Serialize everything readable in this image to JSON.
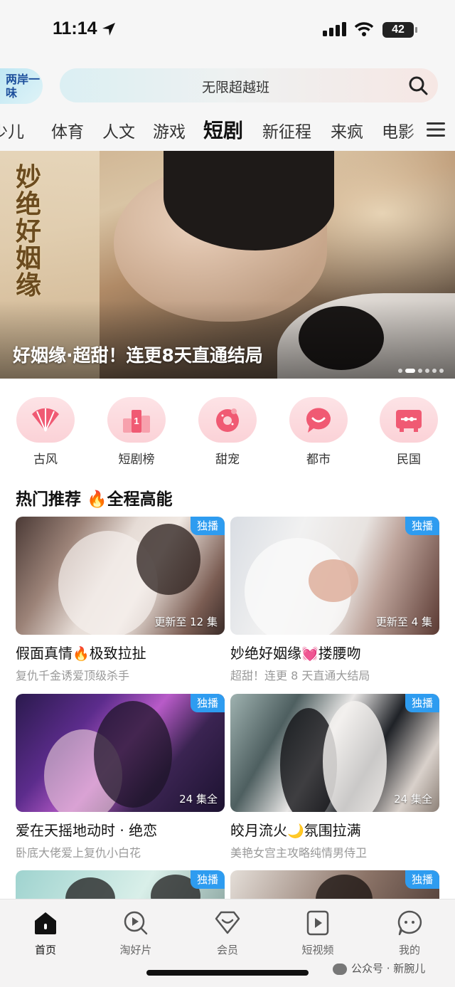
{
  "status_bar": {
    "time": "11:14",
    "battery": "42"
  },
  "header": {
    "brand_logo": "两岸一味",
    "search_placeholder": "无限超越班"
  },
  "tabs": [
    {
      "label": "少儿",
      "active": false
    },
    {
      "label": "体育",
      "active": false
    },
    {
      "label": "人文",
      "active": false
    },
    {
      "label": "游戏",
      "active": false
    },
    {
      "label": "短剧",
      "active": true
    },
    {
      "label": "新征程",
      "active": false
    },
    {
      "label": "来疯",
      "active": false
    },
    {
      "label": "电影",
      "active": false
    }
  ],
  "banner": {
    "calligraphy": "妙绝好姻缘",
    "title": "好姻缘·超甜！连更8天直通结局",
    "page_count": 6,
    "active_index": 1
  },
  "categories": [
    {
      "label": "古风",
      "icon": "fan-icon"
    },
    {
      "label": "短剧榜",
      "icon": "ranking-icon"
    },
    {
      "label": "甜宠",
      "icon": "donut-icon"
    },
    {
      "label": "都市",
      "icon": "speech-bubble-icon"
    },
    {
      "label": "民国",
      "icon": "radio-icon"
    }
  ],
  "section": {
    "title": "热门推荐",
    "emoji": "🔥",
    "subtitle": "全程高能"
  },
  "cards": [
    {
      "badge": "独播",
      "note": "更新至 12 集",
      "title_a": "假面真情",
      "emoji": "🔥",
      "title_b": "极致拉扯",
      "subtitle": "复仇千金诱爱顶级杀手"
    },
    {
      "badge": "独播",
      "note": "更新至 4 集",
      "title_a": "妙绝好姻缘",
      "emoji": "💓",
      "title_b": "搂腰吻",
      "subtitle": "超甜！连更 8 天直通大结局"
    },
    {
      "badge": "独播",
      "note": "24 集全",
      "title_a": "爱在天摇地动时 · 绝恋",
      "emoji": "",
      "title_b": "",
      "subtitle": "卧底大佬爱上复仇小白花"
    },
    {
      "badge": "独播",
      "note": "24 集全",
      "title_a": "皎月流火",
      "emoji": "🌙",
      "title_b": "氛围拉满",
      "subtitle": "美艳女宫主攻略纯情男侍卫"
    },
    {
      "badge": "独播",
      "note": "",
      "title_a": "",
      "emoji": "",
      "title_b": "",
      "subtitle": ""
    },
    {
      "badge": "独播",
      "note": "",
      "title_a": "",
      "emoji": "",
      "title_b": "",
      "subtitle": ""
    }
  ],
  "bottom_nav": [
    {
      "label": "首页",
      "icon": "home-icon",
      "active": true
    },
    {
      "label": "淘好片",
      "icon": "discover-icon",
      "active": false
    },
    {
      "label": "会员",
      "icon": "vip-diamond-icon",
      "active": false
    },
    {
      "label": "短视频",
      "icon": "short-video-icon",
      "active": false
    },
    {
      "label": "我的",
      "icon": "profile-icon",
      "active": false
    }
  ],
  "watermark": "公众号 · 新腕儿",
  "colors": {
    "badge": "#2e9cf0",
    "category_bubble": "#fbd2d7",
    "accent_fire": "#ff5a1f"
  }
}
